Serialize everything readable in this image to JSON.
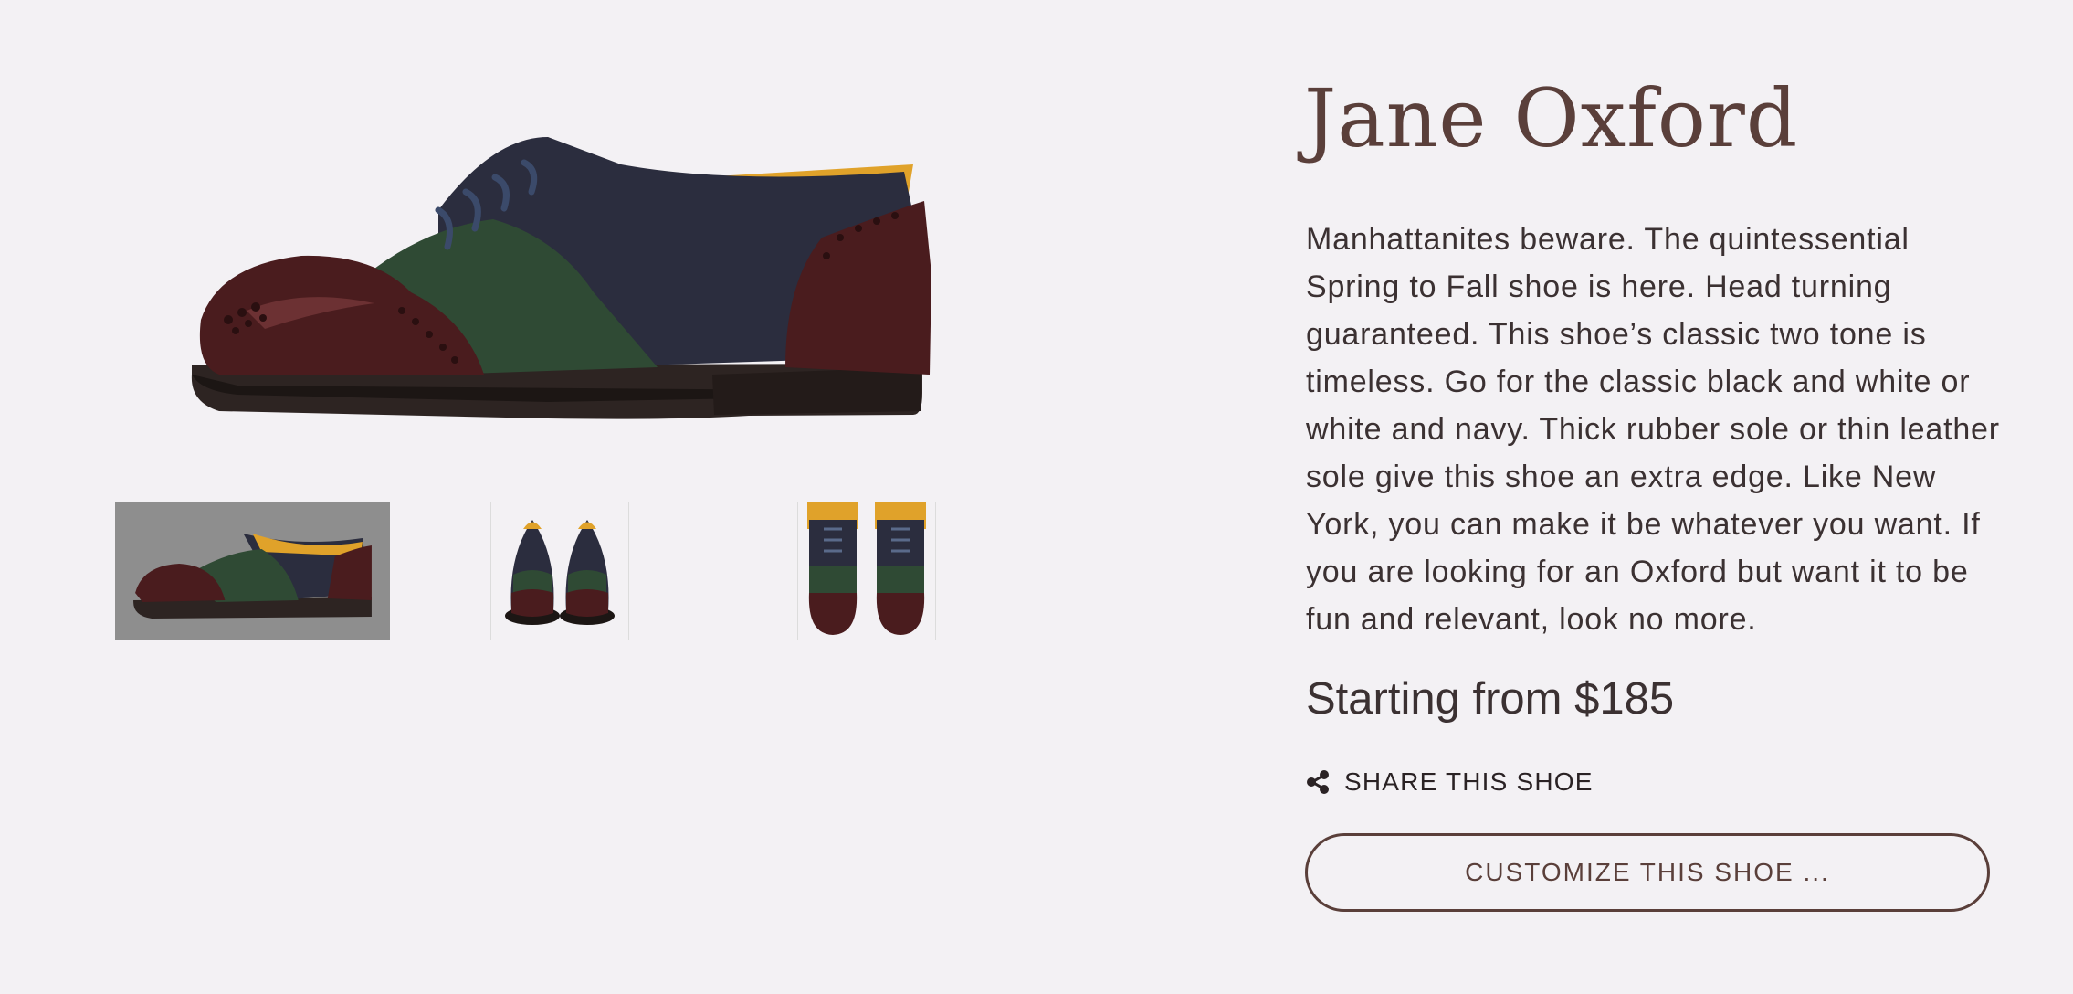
{
  "product": {
    "title": "Jane Oxford",
    "description": "Manhattanites beware. The quintessential Spring to Fall shoe is here. Head turning guaranteed. This shoe’s classic two tone is timeless. Go for the classic black and white or white and navy. Thick rubber sole or thin leather sole give this shoe an extra edge. Like New York, you can make it be whatever you want. If you are looking for an Oxford but want it to be fun and relevant, look no more.",
    "price": "Starting from $185"
  },
  "actions": {
    "share_label": "SHARE THIS SHOE",
    "share_icon": "share-icon",
    "customize_label": "CUSTOMIZE THIS SHOE ..."
  },
  "gallery": {
    "main_image": "shoe-side-view",
    "thumbnails": [
      "shoe-side-view",
      "shoe-front-pair",
      "shoe-top-pair"
    ],
    "selected_index": 0
  },
  "colors": {
    "background": "#f3f1f4",
    "accent": "#5a3f3a",
    "shoe_burgundy": "#4a1c1e",
    "shoe_green": "#2f4a34",
    "shoe_navy": "#2b2d3e",
    "shoe_lining": "#e0a22a"
  }
}
